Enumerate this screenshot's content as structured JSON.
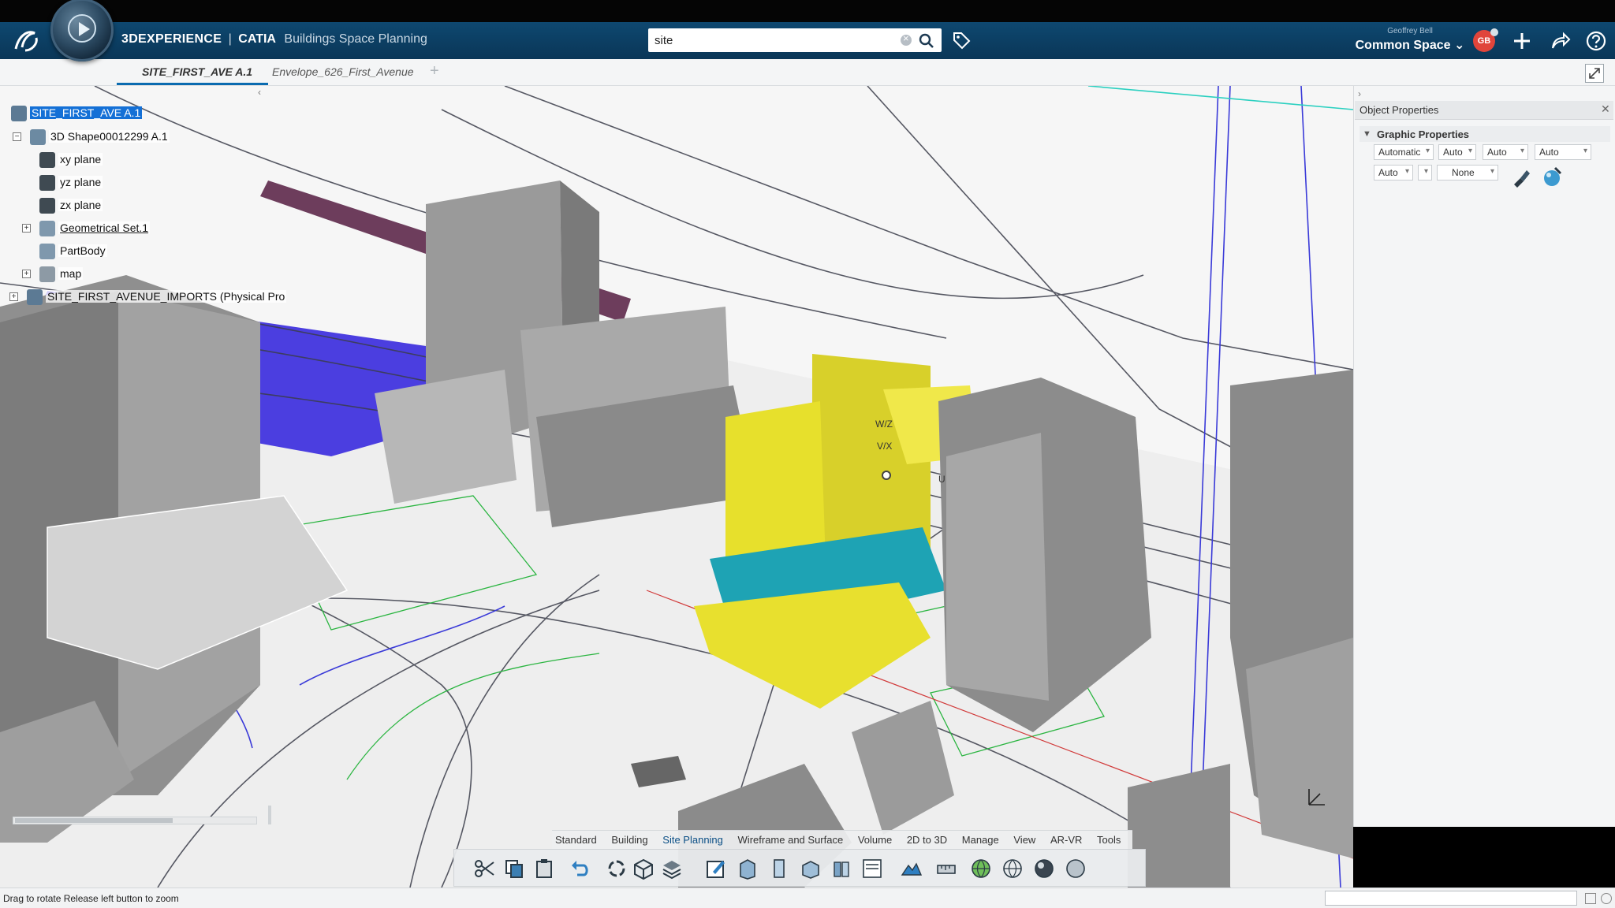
{
  "header": {
    "brand": "3DEXPERIENCE",
    "separator": "|",
    "product": "CATIA",
    "role": "Buildings Space Planning",
    "user_name": "Geoffrey Bell",
    "space": "Common Space",
    "avatar_initials": "GB"
  },
  "search": {
    "value": "site"
  },
  "tabs": [
    {
      "label": "SITE_FIRST_AVE A.1",
      "active": true
    },
    {
      "label": "Envelope_626_First_Avenue",
      "active": false
    }
  ],
  "tree": {
    "root": "SITE_FIRST_AVE A.1",
    "shape": "3D Shape00012299 A.1",
    "xy": "xy plane",
    "yz": "yz plane",
    "zx": "zx plane",
    "geoset": "Geometrical Set.1",
    "body": "PartBody",
    "map": "map",
    "imports": "SITE_FIRST_AVENUE_IMPORTS (Physical Pro"
  },
  "viewport_labels": {
    "wz": "W/Z",
    "vx": "V/X",
    "u": "U"
  },
  "panel": {
    "title": "Object Properties",
    "section": "Graphic Properties",
    "row1": [
      "Automatic",
      "Auto",
      "Auto",
      "Auto"
    ],
    "row2": [
      "Auto",
      "",
      "None"
    ]
  },
  "action_tabs": [
    "Standard",
    "Building",
    "Site Planning",
    "Wireframe and Surface",
    "Volume",
    "2D to 3D",
    "Manage",
    "View",
    "AR-VR",
    "Tools"
  ],
  "status": {
    "message": "Drag to rotate  Release left button to zoom"
  },
  "colors": {
    "titlebar": "#0b3b5f",
    "accent": "#0b6bb0",
    "selection": "#1470d6",
    "envelope_yellow": "#e7e02c",
    "envelope_teal": "#1ea3b4",
    "site_blue": "#4b3ee0"
  }
}
